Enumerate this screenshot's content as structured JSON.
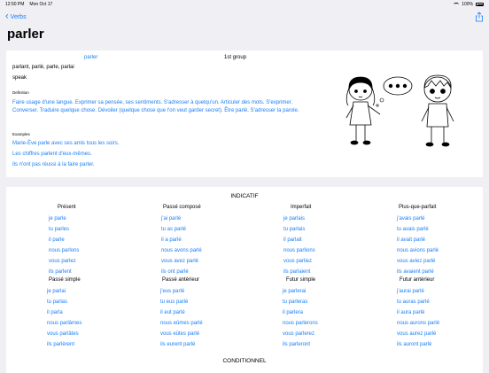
{
  "status": {
    "time": "12:50 PM",
    "date": "Mon Oct 17",
    "battery": "100%"
  },
  "nav": {
    "back_label": "Verbs"
  },
  "verb": {
    "title": "parler",
    "link": "parler",
    "group": "1st group",
    "forms": "parlant, parlé, parle, parlai",
    "meaning": "speak",
    "definition_label": "Definition",
    "definition": "Faire usage d'une langue. Exprimer sa pensée, ses sentiments. S'adresser à quelqu'un. Articuler des mots. S'exprimer. Converser. Traduire quelque chose. Dévoiler (quelque chose que l'on veut garder secret). Être parlé. S'adresser la parole.",
    "examples_label": "Examples",
    "examples": [
      "Marie-Ève parle avec ses amis tous les soirs.",
      "Les chiffres parlent d'eux-mêmes.",
      "Ils n'ont pas réussi à la faire parler."
    ]
  },
  "conjugation": {
    "section_title": "INDICATIF",
    "next_section_title": "CONDITIONNEL",
    "row1": [
      {
        "head": "Présent",
        "items": [
          "je parle",
          "tu parles",
          "il parle",
          "nous parlons",
          "vous parlez",
          "ils parlent"
        ]
      },
      {
        "head": "Passé composé",
        "items": [
          "j'ai parlé",
          "tu as parlé",
          "il a parlé",
          "nous avons parlé",
          "vous avez parlé",
          "ils ont parlé"
        ]
      },
      {
        "head": "Imperfait",
        "items": [
          "je parlais",
          "tu parlais",
          "il parlait",
          "nous parlions",
          "vous parliez",
          "ils parlaient"
        ]
      },
      {
        "head": "Plus-que-parfait",
        "items": [
          "j'avais parlé",
          "tu avais parlé",
          "il avait parlé",
          "nous avions parlé",
          "vous aviez parlé",
          "ils avaient parlé"
        ]
      }
    ],
    "row2": [
      {
        "head": "Passé simple",
        "items": [
          "je parlai",
          "tu parlas",
          "il parla",
          "nous parlâmes",
          "vous parlâtes",
          "ils parlèrent"
        ]
      },
      {
        "head": "Passé antérieur",
        "items": [
          "j'eus parlé",
          "tu eus parlé",
          "il eut parlé",
          "nous eûmes parlé",
          "vous eûtes parlé",
          "ils eurent parlé"
        ]
      },
      {
        "head": "Futur simple",
        "items": [
          "je parlerai",
          "tu parleras",
          "il parlera",
          "nous parlerons",
          "vous parlerez",
          "ils parleront"
        ]
      },
      {
        "head": "Futur antérieur",
        "items": [
          "j'aurai parlé",
          "tu auras parlé",
          "il aura parlé",
          "nous aurons parlé",
          "vous aurez parlé",
          "ils auront parlé"
        ]
      }
    ]
  },
  "colors": {
    "accent": "#1a7ef5",
    "background": "#efeff4"
  }
}
